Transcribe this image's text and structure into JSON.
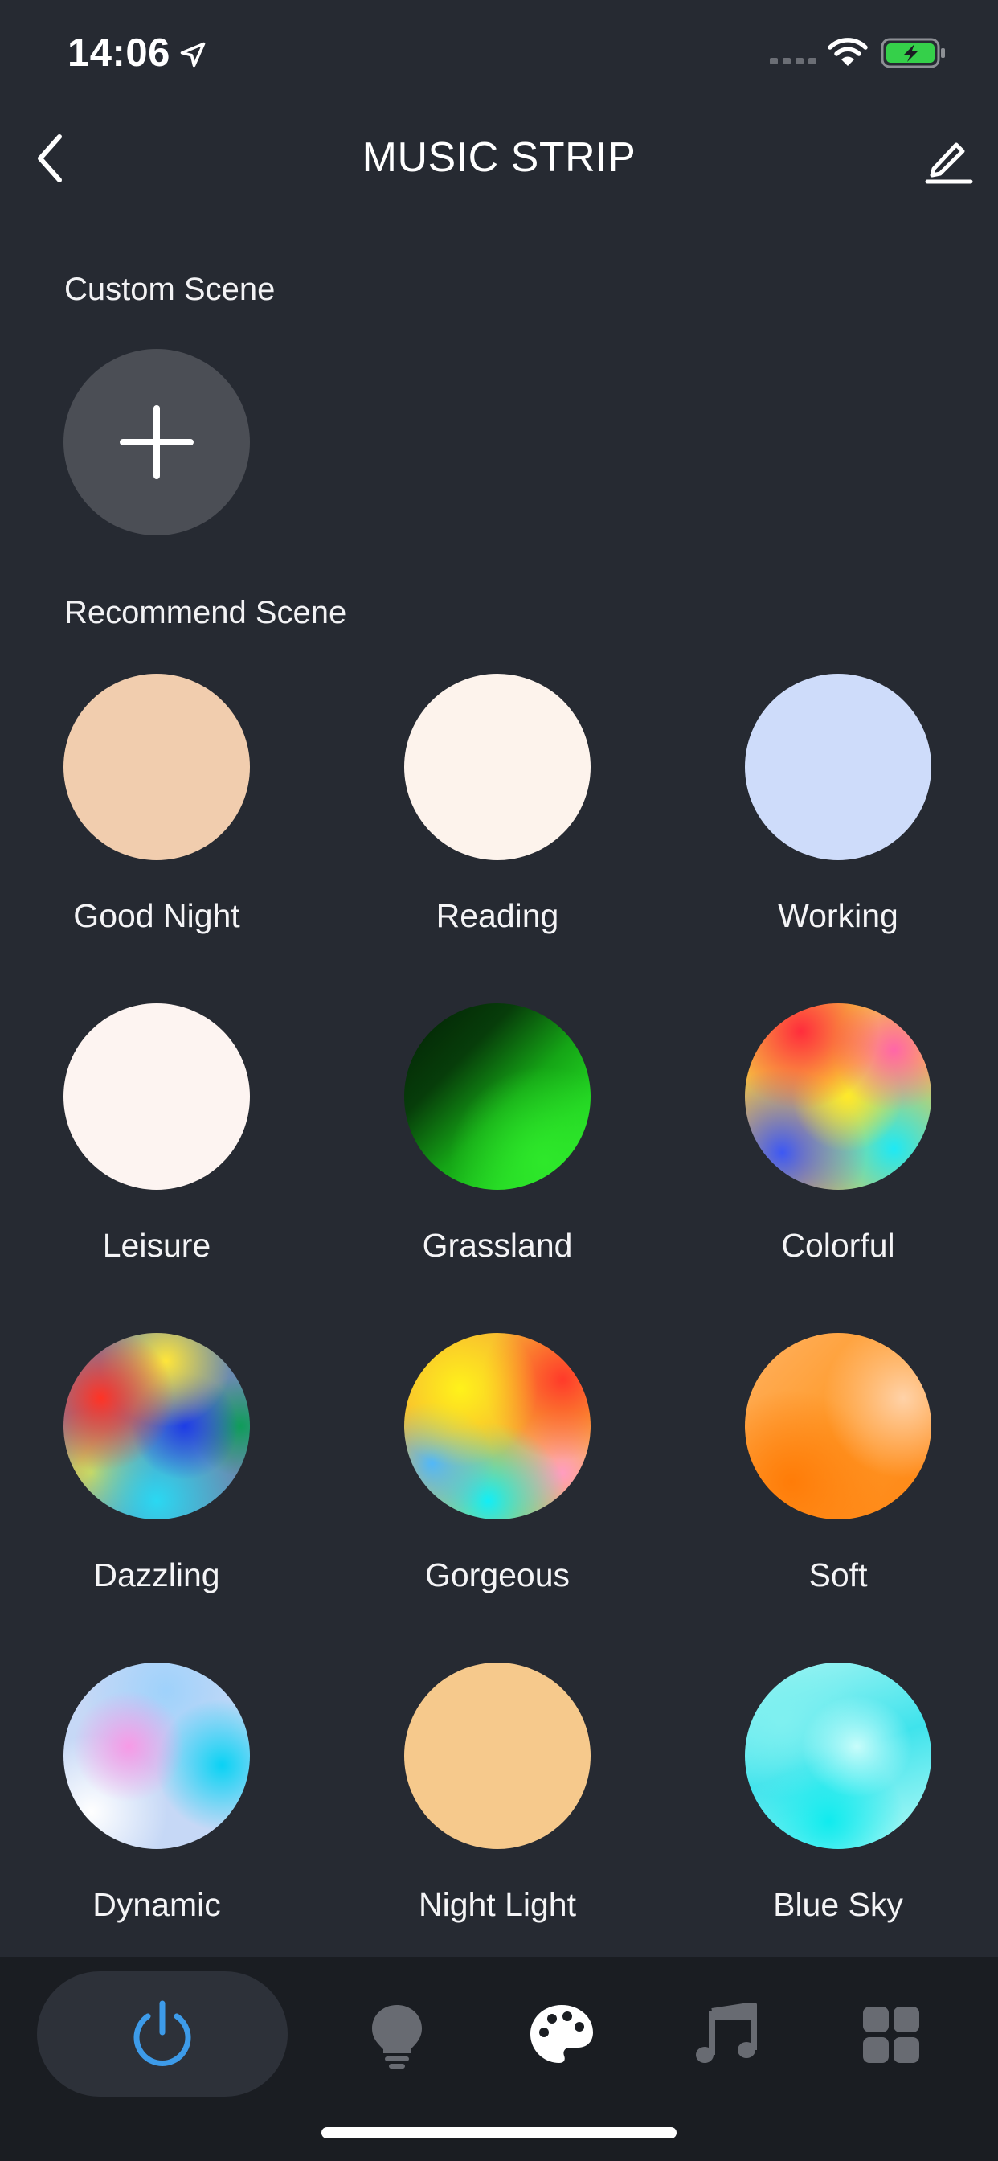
{
  "status_bar": {
    "time": "14:06",
    "icons": [
      "location-arrow-icon",
      "cellular-signal-icon",
      "wifi-icon",
      "battery-charging-icon"
    ]
  },
  "nav": {
    "title": "MUSIC STRIP",
    "back_icon": "chevron-left-icon",
    "edit_icon": "pencil-icon"
  },
  "custom_scene": {
    "title": "Custom Scene",
    "add_icon": "plus-icon"
  },
  "recommend_scene": {
    "title": "Recommend Scene",
    "scenes": [
      {
        "label": "Good Night",
        "color": "#f1cdae"
      },
      {
        "label": "Reading",
        "color": "#fdf3ec"
      },
      {
        "label": "Working",
        "color": "#cedcfa"
      },
      {
        "label": "Leisure",
        "color": "#fdf4f1"
      },
      {
        "label": "Grassland",
        "color": "#22d222"
      },
      {
        "label": "Colorful",
        "color": "#f6c541"
      },
      {
        "label": "Dazzling",
        "color": "#1d3de6"
      },
      {
        "label": "Gorgeous",
        "color": "#fff21a"
      },
      {
        "label": "Soft",
        "color": "#ff9a2a"
      },
      {
        "label": "Dynamic",
        "color": "#f79ae6"
      },
      {
        "label": "Night Light",
        "color": "#f6c98c"
      },
      {
        "label": "Blue Sky",
        "color": "#3fe3ec"
      }
    ]
  },
  "tab_bar": {
    "tabs": [
      {
        "icon": "power-icon",
        "active_color": "#3d9be9"
      },
      {
        "icon": "light-bulb-icon"
      },
      {
        "icon": "palette-icon",
        "selected": true
      },
      {
        "icon": "music-note-icon"
      },
      {
        "icon": "grid-icon"
      }
    ]
  },
  "colors": {
    "background": "#262a32",
    "tab_bar": "#1a1d22",
    "add_button": "#4b4e55",
    "accent_power": "#3d9be9",
    "battery_green": "#35d04a"
  }
}
